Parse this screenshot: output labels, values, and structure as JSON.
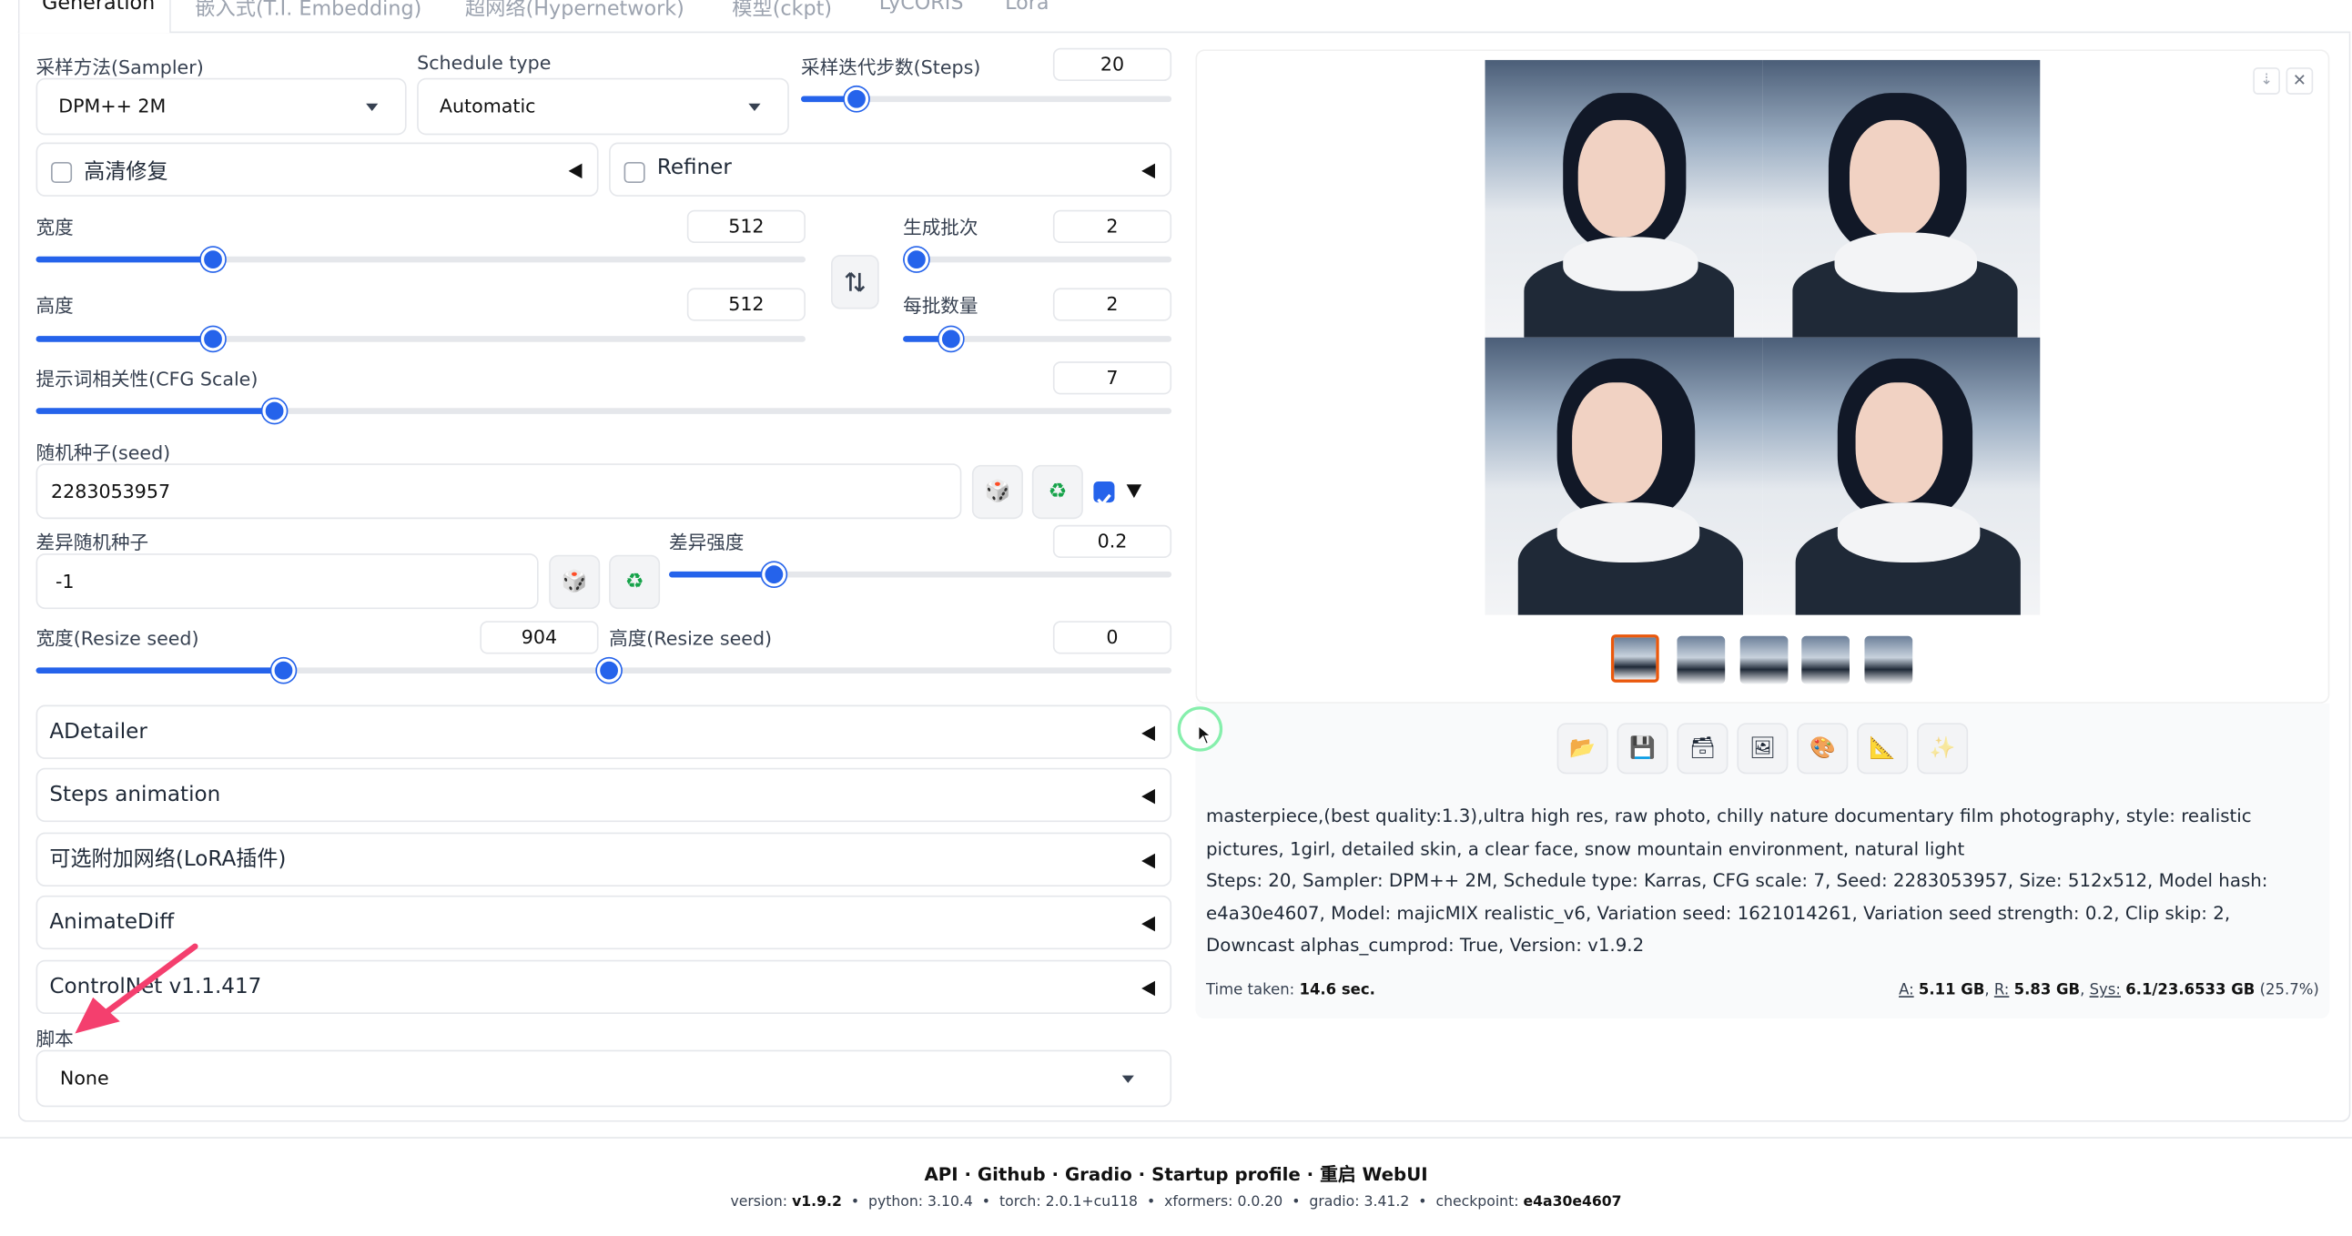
{
  "tabs": [
    "Generation",
    "嵌入式(T.I. Embedding)",
    "超网络(Hypernetwork)",
    "模型(ckpt)",
    "LyCORIS",
    "Lora"
  ],
  "sampler": {
    "label": "采样方法(Sampler)",
    "value": "DPM++ 2M"
  },
  "schedule": {
    "label": "Schedule type",
    "value": "Automatic"
  },
  "steps": {
    "label": "采样迭代步数(Steps)",
    "value": "20",
    "fraction": 0.15
  },
  "hires": {
    "label": "高清修复"
  },
  "refiner": {
    "label": "Refiner"
  },
  "width": {
    "label": "宽度",
    "value": "512",
    "fraction": 0.23
  },
  "height": {
    "label": "高度",
    "value": "512",
    "fraction": 0.23
  },
  "batch_count": {
    "label": "生成批次",
    "value": "2",
    "fraction": 0.05
  },
  "batch_size": {
    "label": "每批数量",
    "value": "2",
    "fraction": 0.18
  },
  "cfg": {
    "label": "提示词相关性(CFG Scale)",
    "value": "7",
    "fraction": 0.21
  },
  "seed": {
    "label": "随机种子(seed)",
    "value": "2283053957"
  },
  "var_seed": {
    "label": "差异随机种子",
    "value": "-1"
  },
  "var_strength": {
    "label": "差异强度",
    "value": "0.2",
    "fraction": 0.21
  },
  "resize_w": {
    "label": "宽度(Resize seed)",
    "value": "904",
    "fraction": 0.44
  },
  "resize_h": {
    "label": "高度(Resize seed)",
    "value": "0",
    "fraction": 0.0
  },
  "accordions": [
    "ADetailer",
    "Steps animation",
    "可选附加网络(LoRA插件)",
    "AnimateDiff",
    "ControlNet v1.1.417"
  ],
  "script": {
    "label": "脚本",
    "value": "None"
  },
  "output": {
    "prompt": "masterpiece,(best quality:1.3),ultra high res, raw photo, chilly nature documentary film photography, style: realistic pictures, 1girl, detailed skin, a clear face, snow mountain environment, natural light",
    "params": "Steps: 20, Sampler: DPM++ 2M, Schedule type: Karras, CFG scale: 7, Seed: 2283053957, Size: 512x512, Model hash: e4a30e4607, Model: majicMIX realistic_v6, Variation seed: 1621014261, Variation seed strength: 0.2, Clip skip: 2, Downcast alphas_cumprod: True, Version: v1.9.2",
    "time_label": "Time taken:",
    "time_value": "14.6 sec.",
    "a_label": "A:",
    "a_value": "5.11 GB",
    "r_label": "R:",
    "r_value": "5.83 GB",
    "sys_label": "Sys:",
    "sys_value": "6.1/23.6533 GB",
    "sys_pct": "(25.7%)"
  },
  "footer": {
    "links": "API · Github · Gradio · Startup profile · 重启 WebUI",
    "version_label": "version:",
    "version": "v1.9.2",
    "python_label": "python:",
    "python": "3.10.4",
    "torch_label": "torch:",
    "torch": "2.0.1+cu118",
    "xformers_label": "xformers:",
    "xformers": "0.0.20",
    "gradio_label": "gradio:",
    "gradio": "3.41.2",
    "checkpoint_label": "checkpoint:",
    "checkpoint": "e4a30e4607"
  },
  "colors": {
    "accent": "#2563eb",
    "annotation_arrow": "#f43f6e",
    "thumb_selected": "#ea580c"
  }
}
